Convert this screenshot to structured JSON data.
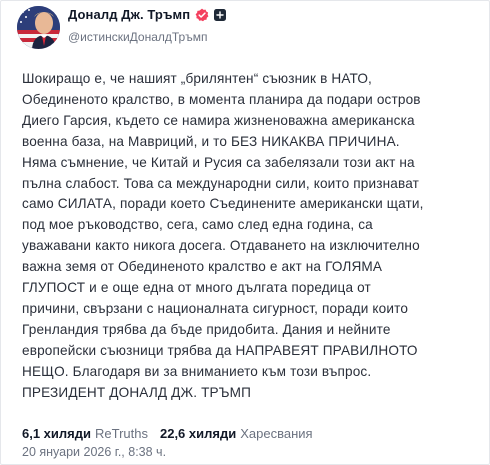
{
  "author": {
    "display_name": "Доналд Дж. Тръмп",
    "handle": "@истинскиДоналдТръмп",
    "avatar_icon": "profile-photo-flag-avatar",
    "verified_icon": "verified-badge-icon",
    "verified_color": "#f43f5e"
  },
  "post": {
    "lines": [
      "Шокиращо е, че нашият „брилянтен“ съюзник в НАТО,",
      "Обединеното кралство, в момента планира да подари остров",
      "Диего Гарсия, където се намира жизненоважна американска",
      "военна база, на Мавриций, и то БЕЗ НИКАКВА ПРИЧИНА.",
      "Няма съмнение, че Китай и Русия са забелязали този акт на",
      "пълна слабост. Това са международни сили, които признават",
      "само СИЛАТА, поради което Съединените американски щати,",
      "под мое ръководство, сега, само след една година, са",
      "уважавани както никога досега. Отдаването на изключително",
      "важна земя от Обединеното кралство е акт на ГОЛЯМА",
      "ГЛУПОСТ и е още една от много дългата поредица от",
      "причини, свързани с националната сигурност, поради които",
      "Гренландия трябва да бъде придобита. Дания и нейните",
      "европейски съюзници трябва да НАПРАВЕЯТ ПРАВИЛНОТО",
      "НЕЩО. Благодаря ви за вниманието към този въпрос.",
      "ПРЕЗИДЕНТ ДОНАЛД ДЖ. ТРЪМП"
    ]
  },
  "stats": {
    "retruths_count": "6,1 хиляди",
    "retruths_label": "ReTruths",
    "likes_count": "22,6 хиляди",
    "likes_label": "Харесвания"
  },
  "timestamp": "20 януари 2026 г., 8:38 ч."
}
